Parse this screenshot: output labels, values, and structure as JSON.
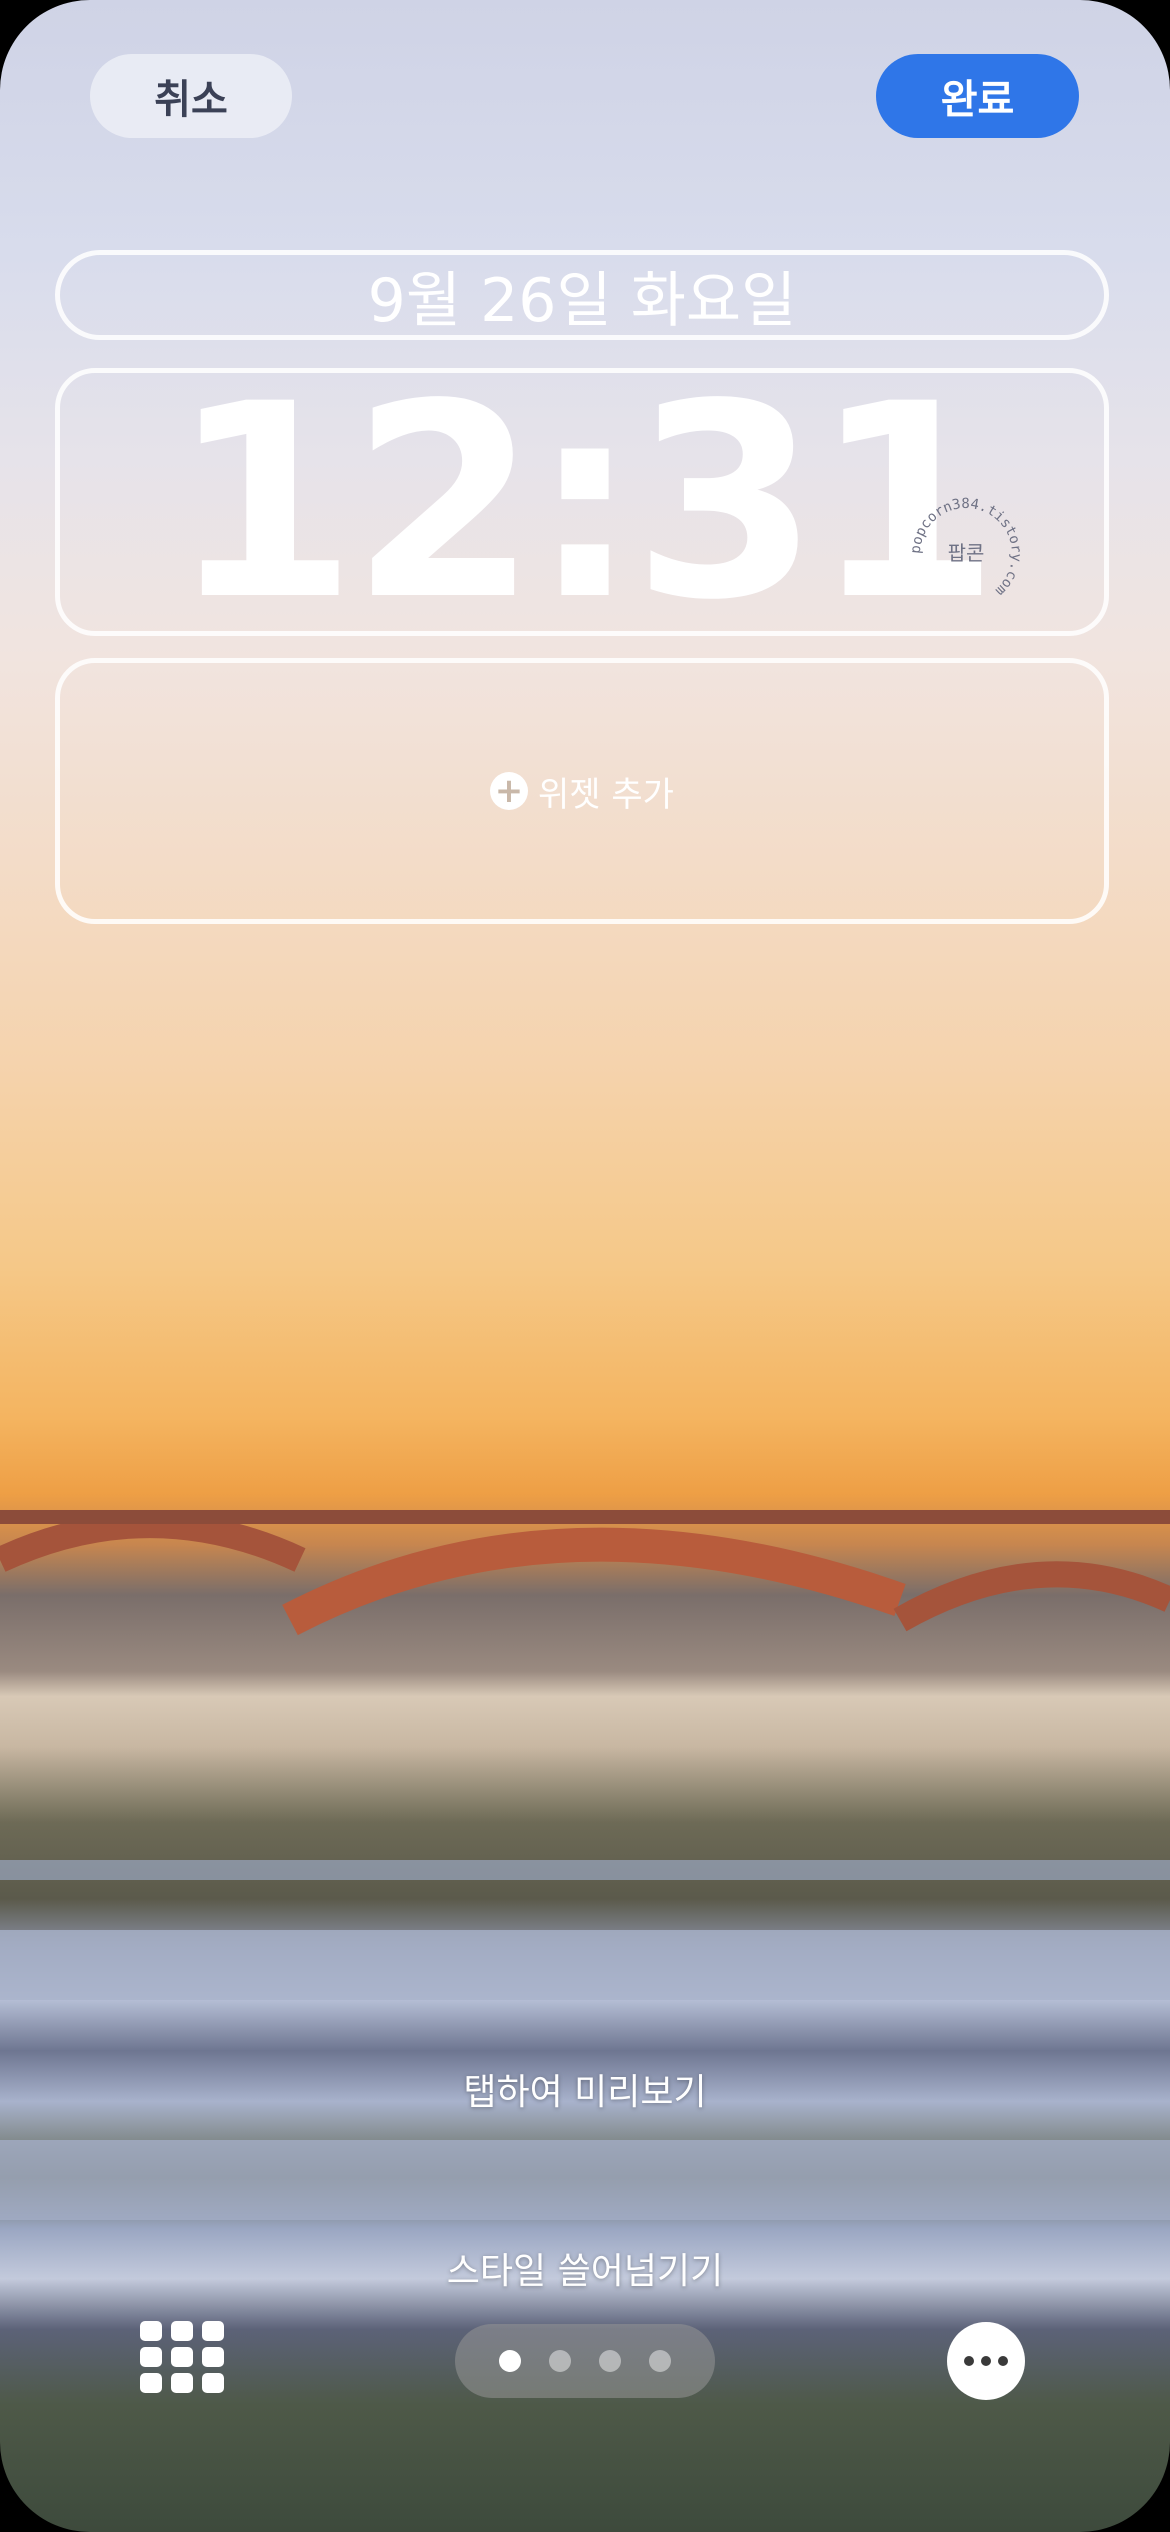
{
  "header": {
    "cancel_label": "취소",
    "done_label": "완료"
  },
  "lock": {
    "date": "9월 26일 화요일",
    "time": "12:31"
  },
  "widgets": {
    "add_label": "위젯 추가"
  },
  "watermark": {
    "text": "popcorn384.tistory.com",
    "inner": "팝콘"
  },
  "hints": {
    "tap_preview": "탭하여 미리보기",
    "swipe_style": "스타일 쓸어넘기기"
  },
  "pager": {
    "count": 4,
    "active_index": 0
  },
  "colors": {
    "accent": "#2f76e8"
  }
}
